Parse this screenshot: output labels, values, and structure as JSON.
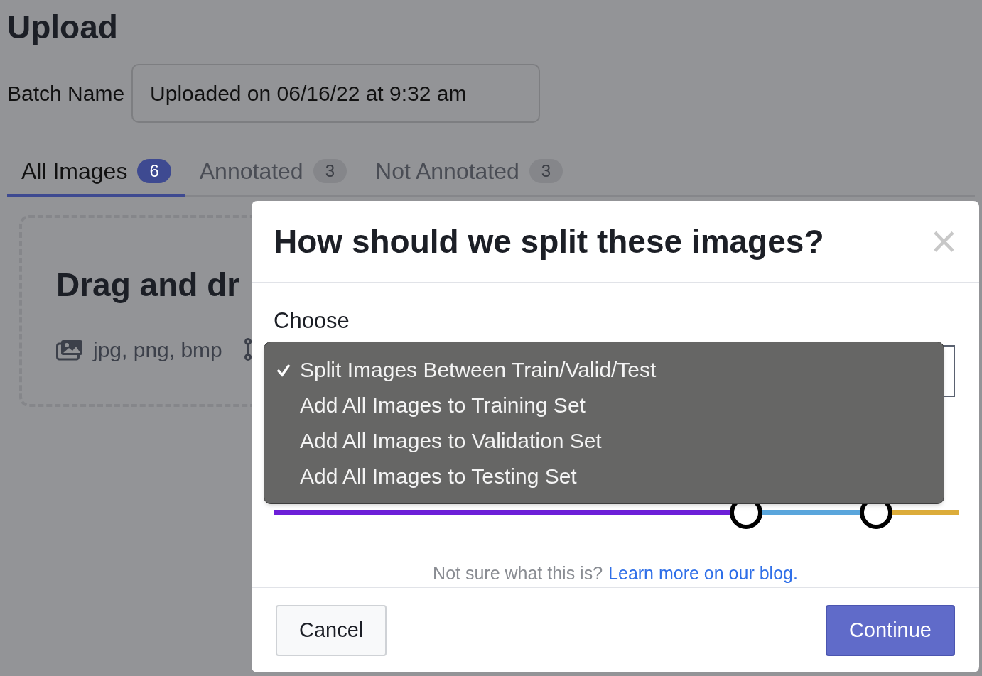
{
  "page": {
    "title": "Upload",
    "batch_label": "Batch Name",
    "batch_value": "Uploaded on 06/16/22 at 9:32 am",
    "tabs": [
      {
        "label": "All Images",
        "count": "6",
        "selected": true
      },
      {
        "label": "Annotated",
        "count": "3",
        "selected": false
      },
      {
        "label": "Not Annotated",
        "count": "3",
        "selected": false
      }
    ],
    "dropzone": {
      "heading": "Drag and dr",
      "formats": "jpg, png, bmp"
    }
  },
  "modal": {
    "title": "How should we split these images?",
    "close": "×",
    "field_label": "Choose",
    "options": [
      {
        "label": "Split Images Between Train/Valid/Test",
        "selected": true
      },
      {
        "label": "Add All Images to Training Set",
        "selected": false
      },
      {
        "label": "Add All Images to Validation Set",
        "selected": false
      },
      {
        "label": "Add All Images to Testing Set",
        "selected": false
      }
    ],
    "segments": [
      {
        "color": "#6d1fd8"
      },
      {
        "color": "#5aa6dc"
      },
      {
        "color": "#dcac3a"
      }
    ],
    "handles": [
      {
        "level": 0.69
      },
      {
        "level": 0.88
      }
    ],
    "help_text": "Not sure what this is?",
    "help_link": "Learn more on our blog.",
    "buttons": [
      {
        "label": "Cancel",
        "kind": "secondary"
      },
      {
        "label": "Continue",
        "kind": "primary"
      }
    ]
  }
}
